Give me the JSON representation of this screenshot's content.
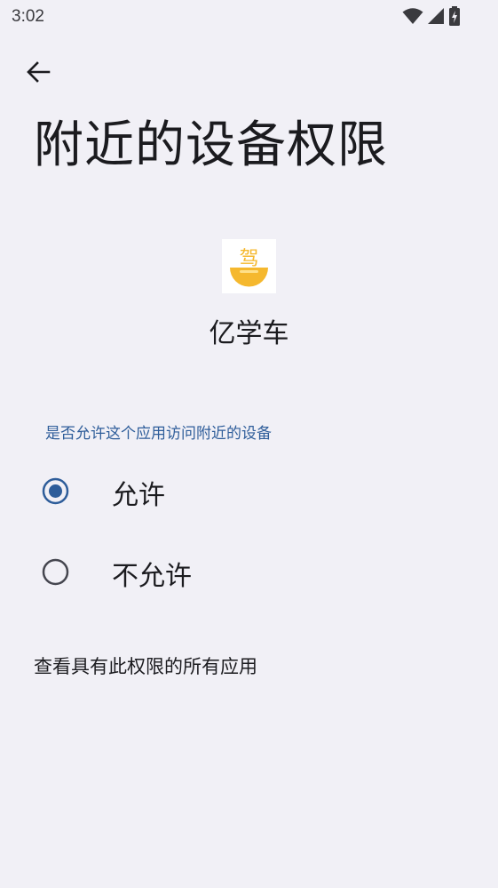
{
  "status_bar": {
    "time": "3:02",
    "icons": [
      "wifi-icon",
      "signal-icon",
      "battery-charging-icon"
    ]
  },
  "header": {
    "back_icon": "back-arrow-icon",
    "title": "附近的设备权限"
  },
  "app": {
    "icon_name": "app-logo-icon",
    "logo_char": "驾",
    "name": "亿学车"
  },
  "permission": {
    "question": "是否允许这个应用访问附近的设备",
    "options": [
      {
        "label": "允许",
        "selected": true
      },
      {
        "label": "不允许",
        "selected": false
      }
    ]
  },
  "footer": {
    "view_all_label": "查看具有此权限的所有应用"
  },
  "colors": {
    "background": "#f1f0f6",
    "accent": "#2e5d9a",
    "text": "#1b1b1f",
    "logo_yellow": "#f5b82e"
  }
}
